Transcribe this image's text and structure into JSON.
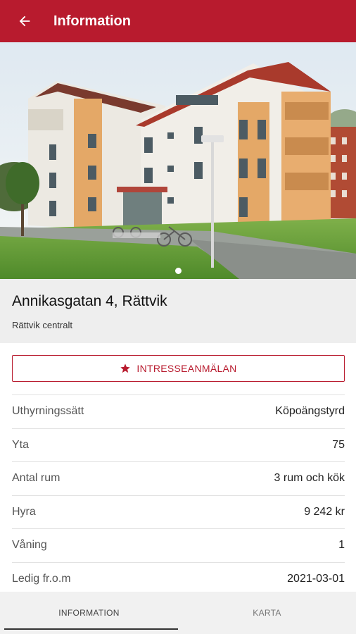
{
  "app_bar": {
    "title": "Information"
  },
  "hero": {
    "slide_count": 1,
    "active_slide": 0
  },
  "listing": {
    "address": "Annikasgatan 4, Rättvik",
    "area": "Rättvik centralt"
  },
  "interest_button": {
    "label": "INTRESSEANMÄLAN"
  },
  "details": [
    {
      "label": "Uthyrningssätt",
      "value": "Köpoängstyrd"
    },
    {
      "label": "Yta",
      "value": "75"
    },
    {
      "label": "Antal rum",
      "value": "3 rum och kök"
    },
    {
      "label": "Hyra",
      "value": "9 242 kr"
    },
    {
      "label": "Våning",
      "value": "1"
    },
    {
      "label": "Ledig fr.o.m",
      "value": "2021-03-01"
    }
  ],
  "bottom_nav": {
    "tabs": [
      "INFORMATION",
      "KARTA"
    ],
    "active": 0
  },
  "colors": {
    "brand": "#b81b2e",
    "panel": "#eeeeee"
  }
}
